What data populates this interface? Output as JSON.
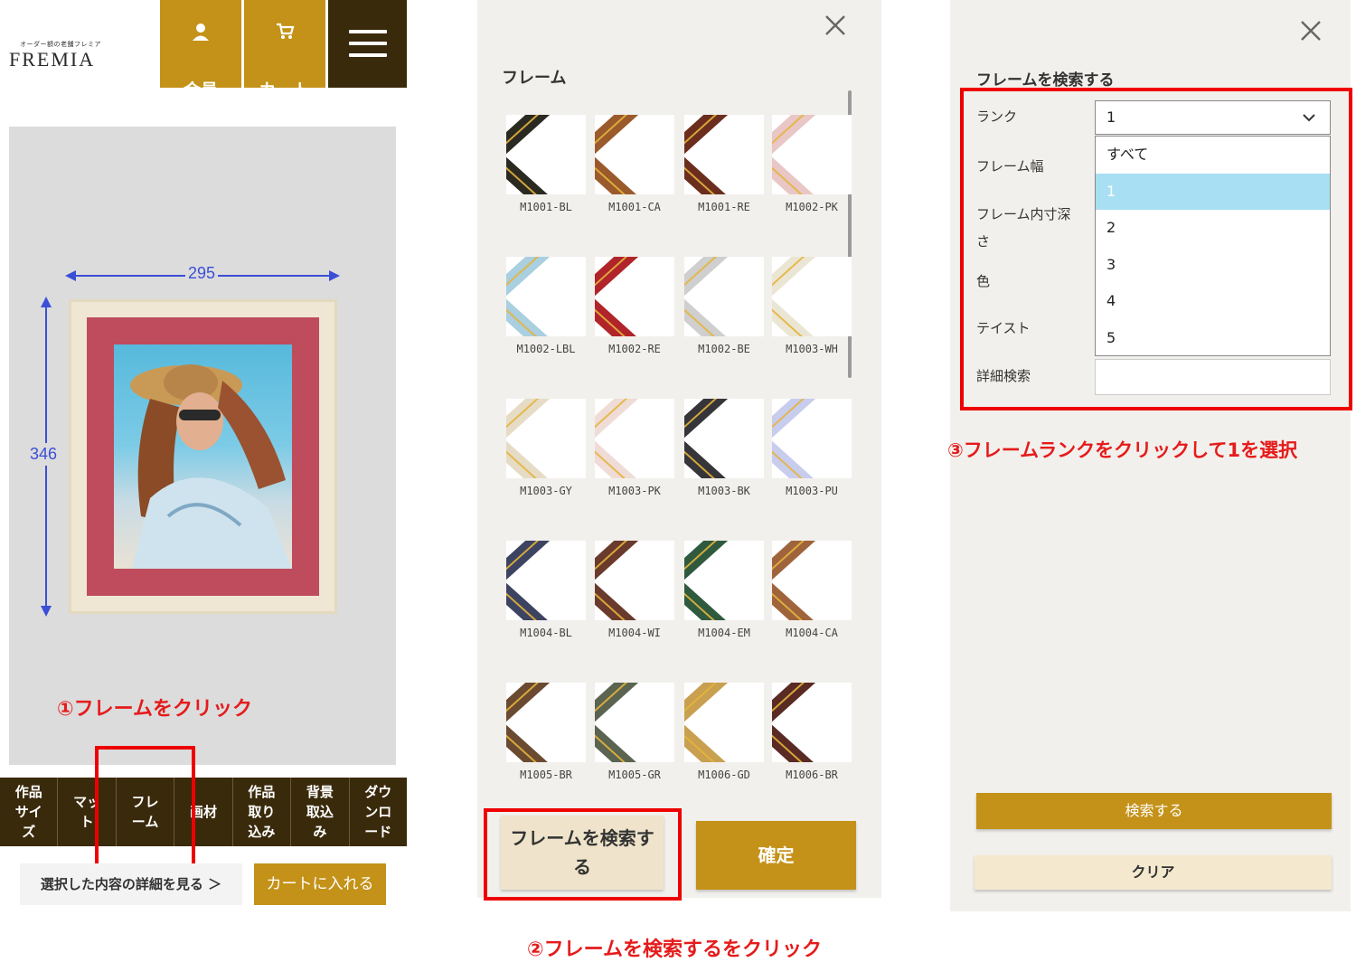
{
  "panel1": {
    "logo_sub": "オーダー額の老舗フレミア",
    "logo_main": "FREMIA",
    "header_buttons": [
      {
        "label": "会員\nページ",
        "icon": "user-icon"
      },
      {
        "label": "カート\nを見る",
        "icon": "cart-icon"
      }
    ],
    "menu_icon": "hamburger-menu-icon",
    "width_value": "295",
    "height_value": "346",
    "annotation": "①フレームをクリック",
    "tabs": [
      "作品\nサイ\nズ",
      "マッ\nト",
      "フレ\nーム",
      "画材",
      "作品\n取り\n込み",
      "背景\n取込\nみ",
      "ダウ\nンロ\nード"
    ],
    "detail_link": "選択した内容の詳細を見る ＞",
    "cart_button": "カートに入れる"
  },
  "panel2": {
    "title": "フレーム",
    "close_icon": "close-icon",
    "frames": [
      {
        "code": "M1001-BL",
        "color": "#2b2a22"
      },
      {
        "code": "M1001-CA",
        "color": "#9a5a2c"
      },
      {
        "code": "M1001-RE",
        "color": "#6b2e1e"
      },
      {
        "code": "M1002-PK",
        "color": "#e9c7c6"
      },
      {
        "code": "M1002-LBL",
        "color": "#a9cfe0"
      },
      {
        "code": "M1002-RE",
        "color": "#b0242a"
      },
      {
        "code": "M1002-BE",
        "color": "#cfcfcf"
      },
      {
        "code": "M1003-WH",
        "color": "#ebe6d4"
      },
      {
        "code": "M1003-GY",
        "color": "#e6dcc6"
      },
      {
        "code": "M1003-PK",
        "color": "#efdcd6"
      },
      {
        "code": "M1003-BK",
        "color": "#35353a"
      },
      {
        "code": "M1003-PU",
        "color": "#c8cdee"
      },
      {
        "code": "M1004-BL",
        "color": "#3c4462"
      },
      {
        "code": "M1004-WI",
        "color": "#6a3a2c"
      },
      {
        "code": "M1004-EM",
        "color": "#2f5a3e"
      },
      {
        "code": "M1004-CA",
        "color": "#a0643c"
      },
      {
        "code": "M1005-BR",
        "color": "#6a4a30"
      },
      {
        "code": "M1005-GR",
        "color": "#5a6450"
      },
      {
        "code": "M1006-GD",
        "color": "#c8a050"
      },
      {
        "code": "M1006-BR",
        "color": "#5a2a24"
      }
    ],
    "search_button": "フレームを検索す\nる",
    "confirm_button": "確定",
    "annotation": "②フレームを検索するをクリック"
  },
  "panel3": {
    "title": "フレームを検索する",
    "close_icon": "close-icon",
    "labels": {
      "rank": "ランク",
      "width": "フレーム幅",
      "depth": "フレーム内寸深\nさ",
      "color": "色",
      "taste": "テイスト",
      "detail": "詳細検索"
    },
    "rank_value": "1",
    "rank_options": [
      "すべて",
      "1",
      "2",
      "3",
      "4",
      "5"
    ],
    "rank_selected": "1",
    "annotation": "③フレームランクをクリックして1を選択",
    "search_button": "検索する",
    "clear_button": "クリア"
  },
  "colors": {
    "gold": "#c49218",
    "dark_brown": "#3a2a0c",
    "annotation_red": "#e51b1b",
    "dimension_blue": "#3b4fd6"
  }
}
